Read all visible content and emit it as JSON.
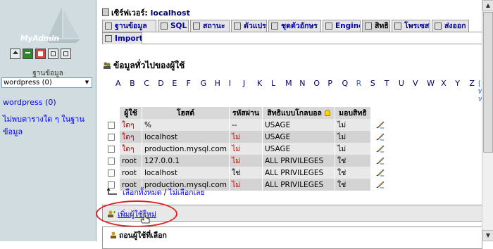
{
  "left": {
    "logo_text_php": "php",
    "logo_text_admin": "MyAdmin",
    "nav_icons": [
      "home-icon",
      "sql-query-icon",
      "query-window-icon",
      "docs-icon",
      "docs-icon"
    ],
    "db_label": "ฐานข้อมูล",
    "db_selected": "wordpress (0)",
    "db_link": "wordpress (0)",
    "no_table_text": "ไม่พบตารางใด ๆ ในฐานข้อมูล"
  },
  "server": {
    "label": "เซิร์ฟเวอร์:",
    "name": "localhost"
  },
  "tabs": [
    {
      "label": "ฐานข้อมูล",
      "icon": "database-icon"
    },
    {
      "label": "SQL",
      "icon": "sql-icon"
    },
    {
      "label": "สถานะ",
      "icon": "status-icon"
    },
    {
      "label": "ตัวแปร",
      "icon": "variables-icon"
    },
    {
      "label": "ชุดตัวอักษร",
      "icon": "charsets-icon"
    },
    {
      "label": "Engines",
      "icon": "engines-icon"
    },
    {
      "label": "สิทธิ",
      "icon": "privileges-icon"
    },
    {
      "label": "โพรเซส",
      "icon": "processes-icon"
    },
    {
      "label": "ส่งออก",
      "icon": "export-icon"
    },
    {
      "label": "Import",
      "icon": "import-icon"
    }
  ],
  "active_tab": 6,
  "heading": "ข้อมูลทั่วไปของผู้ใช้",
  "alphabet": [
    "A",
    "B",
    "C",
    "D",
    "E",
    "F",
    "G",
    "H",
    "I",
    "J",
    "K",
    "L",
    "M",
    "N",
    "O",
    "P",
    "Q",
    "R",
    "S",
    "T",
    "U",
    "V",
    "W",
    "X",
    "Y",
    "Z"
  ],
  "alphabet_current": "R",
  "right_stub": "[\nท\nห",
  "table": {
    "headers": [
      "ผู้ใช้",
      "โฮสต์",
      "รหัสผ่าน",
      "สิทธิแบบโกลบอล",
      "มอบสิทธิ"
    ],
    "rows": [
      {
        "user": "ใดๆ",
        "user_red": true,
        "host": "%",
        "password": "--",
        "password_red": false,
        "privileges": "USAGE",
        "grant": "ไม่"
      },
      {
        "user": "ใดๆ",
        "user_red": true,
        "host": "localhost",
        "password": "ไม่",
        "password_red": true,
        "privileges": "USAGE",
        "grant": "ไม่"
      },
      {
        "user": "ใดๆ",
        "user_red": true,
        "host": "production.mysql.com",
        "password": "ไม่",
        "password_red": true,
        "privileges": "USAGE",
        "grant": "ไม่"
      },
      {
        "user": "root",
        "user_red": false,
        "host": "127.0.0.1",
        "password": "ไม่",
        "password_red": true,
        "privileges": "ALL PRIVILEGES",
        "grant": "ใช่"
      },
      {
        "user": "root",
        "user_red": false,
        "host": "localhost",
        "password": "ใช่",
        "password_red": false,
        "privileges": "ALL PRIVILEGES",
        "grant": "ใช่"
      },
      {
        "user": "root",
        "user_red": false,
        "host": "production.mysql.com",
        "password": "ไม่",
        "password_red": true,
        "privileges": "ALL PRIVILEGES",
        "grant": "ใช่"
      }
    ]
  },
  "select_all": "เลือกทั้งหมด",
  "select_sep": " / ",
  "deselect_all": "ไม่เลือกเลย",
  "add_user": "เพิ่มผู้ใช้ใหม่",
  "remove_selected": "ถอนผู้ใช้ที่เลือก",
  "colors": {
    "highlight_oval": "#e02020",
    "link": "#0000ff",
    "no_red": "#cc0000"
  }
}
